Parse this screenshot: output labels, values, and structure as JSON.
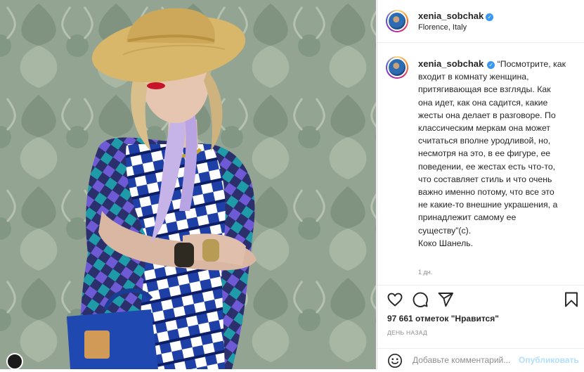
{
  "post": {
    "username": "xenia_sobchak",
    "location": "Florence, Italy",
    "caption_lines": [
      "“Посмотрите, как",
      "входит в комнату женщина,",
      "притягивающая все взгляды. Как",
      "она идет, как она садится, какие",
      "жесты она делает в разговоре. По",
      "классическим меркам она может",
      "считаться вполне уродливой, но,",
      "несмотря на это, в ее фигуре, ее",
      "поведении, ее жестах есть что-то,",
      "что составляет стиль и что очень",
      "важно именно потому, что все это",
      "не какие-то внешние украшения, а",
      "принадлежит самому ее",
      "существу”(с).",
      "Коко Шанель."
    ],
    "caption_time": "1 дн.",
    "likes": "97 661 отметок \"Нравится\"",
    "date_label": "ДЕНЬ НАЗАД"
  },
  "comment": {
    "placeholder": "Добавьте комментарий...",
    "publish_label": "Опубликовать"
  },
  "icons": {
    "verified": "verified-badge-icon",
    "like": "heart-icon",
    "comment": "comment-bubble-icon",
    "share": "paper-plane-icon",
    "save": "bookmark-icon",
    "emoji": "smiley-icon"
  },
  "colors": {
    "verified": "#3897f0",
    "publish_disabled": "#b2dffc",
    "muted_text": "#8e8e8e"
  }
}
